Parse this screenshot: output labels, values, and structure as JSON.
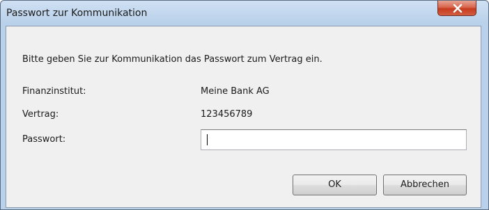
{
  "window": {
    "title": "Passwort zur Kommunikation"
  },
  "dialog": {
    "instruction": "Bitte geben Sie zur Kommunikation das Passwort zum Vertrag ein.",
    "fields": {
      "institution_label": "Finanzinstitut:",
      "institution_value": "Meine Bank AG",
      "contract_label": "Vertrag:",
      "contract_value": "123456789",
      "password_label": "Passwort:",
      "password_value": ""
    },
    "buttons": {
      "ok": "OK",
      "cancel": "Abbrechen"
    }
  },
  "icons": {
    "close": "close-icon"
  },
  "colors": {
    "titlebar": "#b9d1ea",
    "close_button": "#c63b1f",
    "client_background": "#f0f0f0"
  }
}
